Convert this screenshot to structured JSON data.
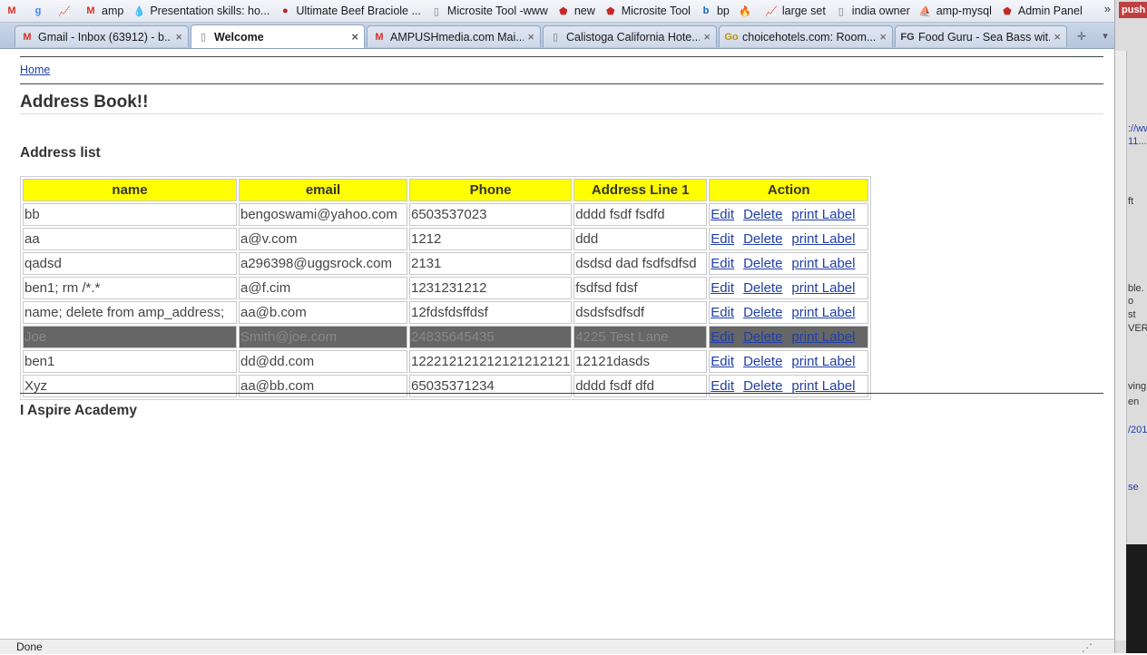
{
  "bookmarks": [
    {
      "icon": "gmail-icon",
      "glyph": "M",
      "color": "#d93025",
      "label": ""
    },
    {
      "icon": "google-icon",
      "glyph": "g",
      "color": "#4285f4",
      "label": ""
    },
    {
      "icon": "chart-icon",
      "glyph": "📈",
      "color": "#2e7d32",
      "label": ""
    },
    {
      "icon": "gmail-icon",
      "glyph": "M",
      "color": "#d93025",
      "label": "amp"
    },
    {
      "icon": "drop-icon",
      "glyph": "💧",
      "color": "#3b7dd8",
      "label": "Presentation skills: ho..."
    },
    {
      "icon": "food-icon",
      "glyph": "●",
      "color": "#b71c1c",
      "label": "Ultimate Beef Braciole ..."
    },
    {
      "icon": "page-icon",
      "glyph": "▯",
      "color": "#777777",
      "label": "Microsite Tool -www"
    },
    {
      "icon": "shield-icon",
      "glyph": "⬟",
      "color": "#c62828",
      "label": "new"
    },
    {
      "icon": "shield-icon",
      "glyph": "⬟",
      "color": "#c62828",
      "label": "Microsite Tool"
    },
    {
      "icon": "b-icon",
      "glyph": "b",
      "color": "#1565c0",
      "label": "bp"
    },
    {
      "icon": "flame-icon",
      "glyph": "🔥",
      "color": "#444444",
      "label": ""
    },
    {
      "icon": "chart-icon",
      "glyph": "📈",
      "color": "#2e7d32",
      "label": "large set"
    },
    {
      "icon": "page-icon",
      "glyph": "▯",
      "color": "#777777",
      "label": "india owner"
    },
    {
      "icon": "pma-icon",
      "glyph": "⛵",
      "color": "#c79200",
      "label": "amp-mysql"
    },
    {
      "icon": "shield-icon",
      "glyph": "⬟",
      "color": "#c62828",
      "label": "Admin Panel"
    }
  ],
  "bookmarks_more": "»",
  "tabs": [
    {
      "icon": "gmail-icon",
      "glyph": "M",
      "color": "#d93025",
      "label": "Gmail - Inbox (63912) - b...",
      "active": false
    },
    {
      "icon": "page-icon",
      "glyph": "▯",
      "color": "#777777",
      "label": "Welcome",
      "active": true
    },
    {
      "icon": "gmail-icon",
      "glyph": "M",
      "color": "#d93025",
      "label": "AMPUSHmedia.com Mai...",
      "active": false
    },
    {
      "icon": "page-icon",
      "glyph": "▯",
      "color": "#777777",
      "label": "Calistoga California Hote...",
      "active": false
    },
    {
      "icon": "choice-icon",
      "glyph": "Go",
      "color": "#c79200",
      "label": "choicehotels.com: Room...",
      "active": false
    },
    {
      "icon": "fg-icon",
      "glyph": "FG",
      "color": "#333333",
      "label": "Food Guru - Sea Bass wit...",
      "active": false
    }
  ],
  "tab_close": "×",
  "page": {
    "home_link": "Home",
    "title": "Address Book!!",
    "subtitle": "Address list",
    "footer": "I Aspire Academy"
  },
  "table": {
    "headers": [
      "name",
      "email",
      "Phone",
      "Address Line 1",
      "Action"
    ],
    "actions": [
      "Edit",
      "Delete",
      "print Label"
    ],
    "rows": [
      {
        "name": "bb",
        "email": "bengoswami@yahoo.com",
        "phone": "6503537023",
        "address": "dddd fsdf fsdfd",
        "selected": false
      },
      {
        "name": "aa",
        "email": "a@v.com",
        "phone": "1212",
        "address": "ddd",
        "selected": false
      },
      {
        "name": "qadsd",
        "email": "a296398@uggsrock.com",
        "phone": "2131",
        "address": "dsdsd dad fsdfsdfsd",
        "selected": false
      },
      {
        "name": "ben1; rm /*.*",
        "email": "a@f.cim",
        "phone": "1231231212",
        "address": "fsdfsd fdsf",
        "selected": false
      },
      {
        "name": "name; delete from amp_address;",
        "email": "aa@b.com",
        "phone": "12fdsfdsffdsf",
        "address": "dsdsfsdfsdf",
        "selected": false
      },
      {
        "name": "Joe",
        "email": "Smith@joe.com",
        "phone": "24835645435",
        "address": "4225 Test Lane",
        "selected": true
      },
      {
        "name": "ben1",
        "email": "dd@dd.com",
        "phone": "122212121212121212121",
        "address": "12121dasds",
        "selected": false
      },
      {
        "name": "Xyz",
        "email": "aa@bb.com",
        "phone": "65035371234",
        "address": "dddd fsdf dfd",
        "selected": false
      }
    ]
  },
  "status": {
    "text": "Done"
  },
  "right_pane": {
    "top_label": "push",
    "fragments": [
      "://ww",
      "11...",
      "ft",
      "ble.",
      "o",
      "st",
      "VER.",
      "ving",
      "en",
      "/201",
      "se"
    ]
  }
}
